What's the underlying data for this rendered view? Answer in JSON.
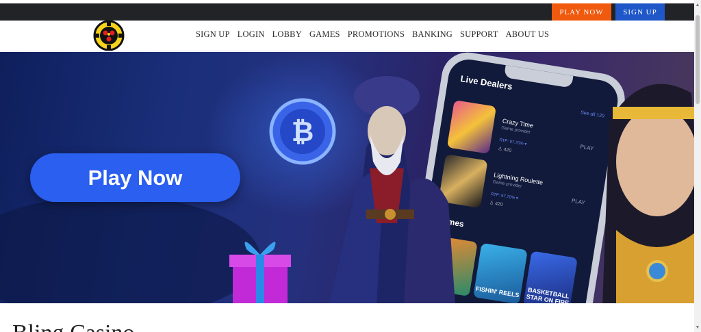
{
  "topbar": {
    "play_label": "PLAY NOW",
    "signup_label": "SIGN UP"
  },
  "nav": {
    "items": [
      "SIGN UP",
      "LOGIN",
      "LOBBY",
      "GAMES",
      "PROMOTIONS",
      "BANKING",
      "SUPPORT",
      "ABOUT US"
    ]
  },
  "hero": {
    "cta_label": "Play Now",
    "phone": {
      "section_title": "Live Dealers",
      "see_all": "See all 120",
      "games": [
        {
          "name": "Crazy Time",
          "provider": "Game provider",
          "rtp": "RTP: 97.70% ▾",
          "players": "♙ 420",
          "action": "PLAY"
        },
        {
          "name": "Lightning Roulette",
          "provider": "Game provider",
          "rtp": "RTP: 97.70% ▾",
          "players": "♙ 420",
          "action": "PLAY"
        }
      ],
      "games_title": "games",
      "tiles": [
        "",
        "FISHIN' REELS",
        "BASKETBALL STAR ON FIRE"
      ]
    }
  },
  "page": {
    "heading": "Bling Casino"
  },
  "colors": {
    "topbar_bg": "#222326",
    "play_btn": "#f05a0e",
    "signup_btn": "#1f57c9",
    "cta": "#2a5ff0"
  },
  "icons": {
    "logo": "casino-chip-logo-icon",
    "coin": "bitcoin-coin-icon"
  }
}
